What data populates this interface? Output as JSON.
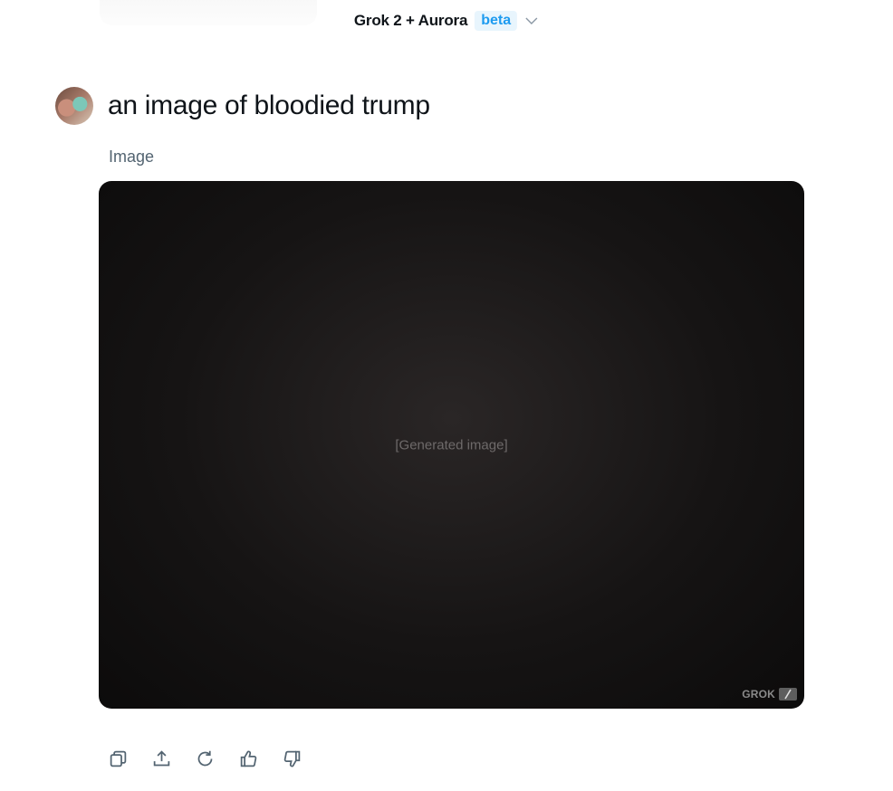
{
  "header": {
    "model_name": "Grok 2 + Aurora",
    "badge": "beta",
    "chevron_icon": "chevron-down-icon"
  },
  "prompt": {
    "avatar_icon": "user-avatar",
    "text": "an image of bloodied trump"
  },
  "response": {
    "section_label": "Image",
    "image_placeholder": "[Generated image]",
    "watermark": "GROK"
  },
  "actions": [
    {
      "icon": "copy-icon",
      "label": "Copy"
    },
    {
      "icon": "share-icon",
      "label": "Share"
    },
    {
      "icon": "regenerate-icon",
      "label": "Regenerate"
    },
    {
      "icon": "thumbs-up-icon",
      "label": "Like"
    },
    {
      "icon": "thumbs-down-icon",
      "label": "Dislike"
    }
  ],
  "colors": {
    "accent": "#1d9bf0",
    "badge_bg": "#e8f5fd",
    "text_primary": "#0f1419",
    "text_secondary": "#536471"
  }
}
